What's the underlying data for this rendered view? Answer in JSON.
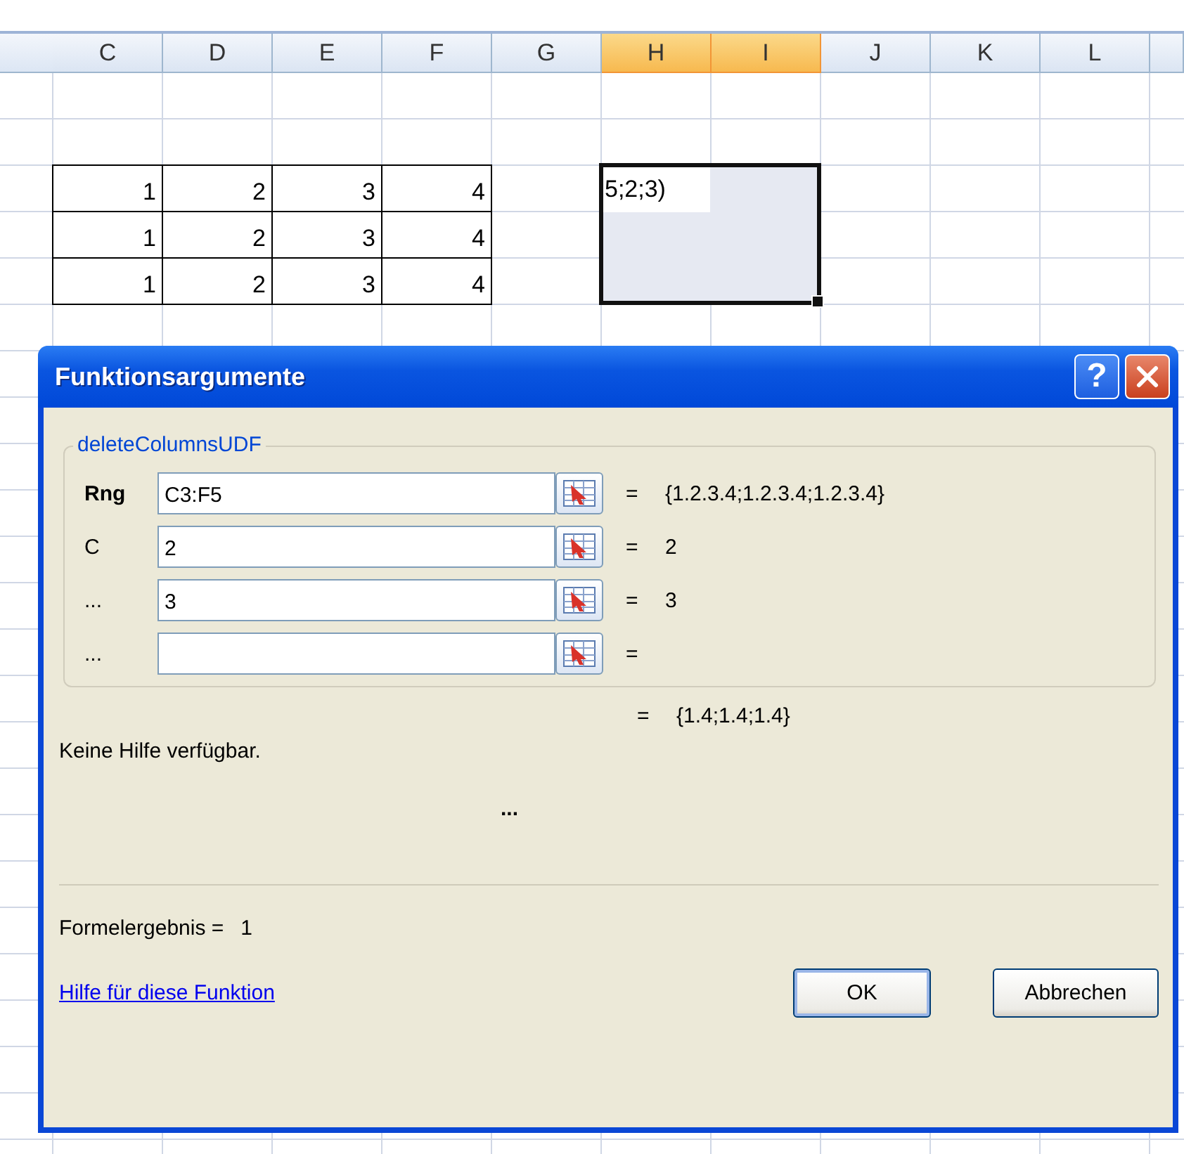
{
  "columns": [
    {
      "label": "C",
      "selected": false
    },
    {
      "label": "D",
      "selected": false
    },
    {
      "label": "E",
      "selected": false
    },
    {
      "label": "F",
      "selected": false
    },
    {
      "label": "G",
      "selected": false
    },
    {
      "label": "H",
      "selected": true
    },
    {
      "label": "I",
      "selected": true
    },
    {
      "label": "J",
      "selected": false
    },
    {
      "label": "K",
      "selected": false
    },
    {
      "label": "L",
      "selected": false
    }
  ],
  "data_rows": [
    [
      "1",
      "2",
      "3",
      "4"
    ],
    [
      "1",
      "2",
      "3",
      "4"
    ],
    [
      "1",
      "2",
      "3",
      "4"
    ]
  ],
  "selection": {
    "text": "5;2;3)"
  },
  "dialog": {
    "title": "Funktionsargumente",
    "help_button": "?",
    "group_title": "deleteColumnsUDF",
    "arguments": [
      {
        "label": "Rng",
        "bold": true,
        "value": "C3:F5",
        "equals": "=",
        "result": "{1.2.3.4;1.2.3.4;1.2.3.4}"
      },
      {
        "label": "C",
        "bold": false,
        "value": "2",
        "equals": "=",
        "result": "2"
      },
      {
        "label": "...",
        "bold": false,
        "value": "3",
        "equals": "=",
        "result": "3"
      },
      {
        "label": "...",
        "bold": false,
        "equals": "="
      }
    ],
    "function_result": {
      "equals": "=",
      "value": "{1.4;1.4;1.4}"
    },
    "description": "Keine Hilfe verfügbar.",
    "argument_description": "...",
    "formula_result": {
      "label": "Formelergebnis =",
      "value": "1"
    },
    "help_link": "Hilfe für diese Funktion",
    "buttons": [
      "OK",
      "Abbrechen"
    ]
  }
}
